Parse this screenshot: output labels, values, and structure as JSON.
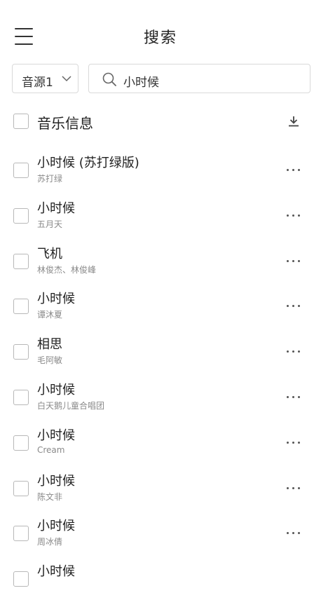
{
  "header": {
    "title": "搜索",
    "menu_icon": "hamburger-menu-icon"
  },
  "search": {
    "source_label": "音源1",
    "query": "小时候",
    "search_icon": "search-icon",
    "dropdown_icon": "chevron-down-icon"
  },
  "list_header": {
    "title": "音乐信息",
    "download_icon": "download-icon"
  },
  "songs": [
    {
      "name": "小时候 (苏打绿版)",
      "artist": "苏打绿"
    },
    {
      "name": "小时候",
      "artist": "五月天"
    },
    {
      "name": "飞机",
      "artist": "林俊杰、林俊峰"
    },
    {
      "name": "小时候",
      "artist": "谭沐夏"
    },
    {
      "name": "相思",
      "artist": "毛阿敏"
    },
    {
      "name": "小时候",
      "artist": "白天鹅儿童合唱团"
    },
    {
      "name": "小时候",
      "artist": "Cream"
    },
    {
      "name": "小时候",
      "artist": "陈文非"
    },
    {
      "name": "小时候",
      "artist": "周冰倩"
    },
    {
      "name": "小时候",
      "artist": ""
    }
  ],
  "colors": {
    "text": "#222222",
    "secondary": "#8a8a8a",
    "border": "#d9d9d9"
  }
}
